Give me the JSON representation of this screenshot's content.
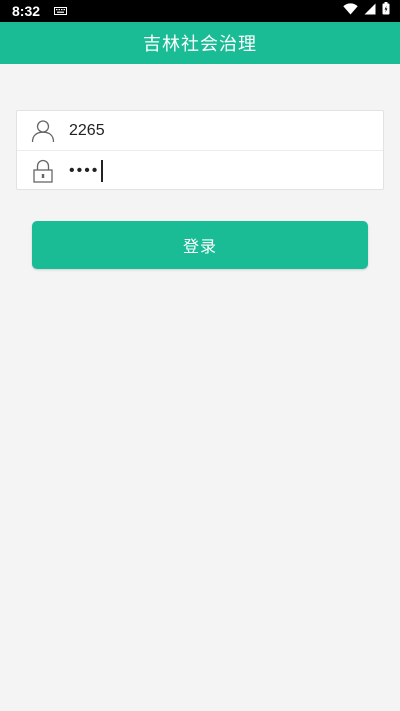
{
  "status_bar": {
    "time": "8:32",
    "icons": [
      "keyboard-icon",
      "wifi-icon",
      "cellular-icon",
      "battery-icon"
    ]
  },
  "app_bar": {
    "title": "吉林社会治理",
    "color": "#1abc96"
  },
  "login_form": {
    "username": {
      "icon": "user-icon",
      "value": "2265"
    },
    "password": {
      "icon": "lock-icon",
      "masked_value": "••••"
    }
  },
  "login_button": {
    "label": "登录",
    "color": "#1abc96"
  }
}
